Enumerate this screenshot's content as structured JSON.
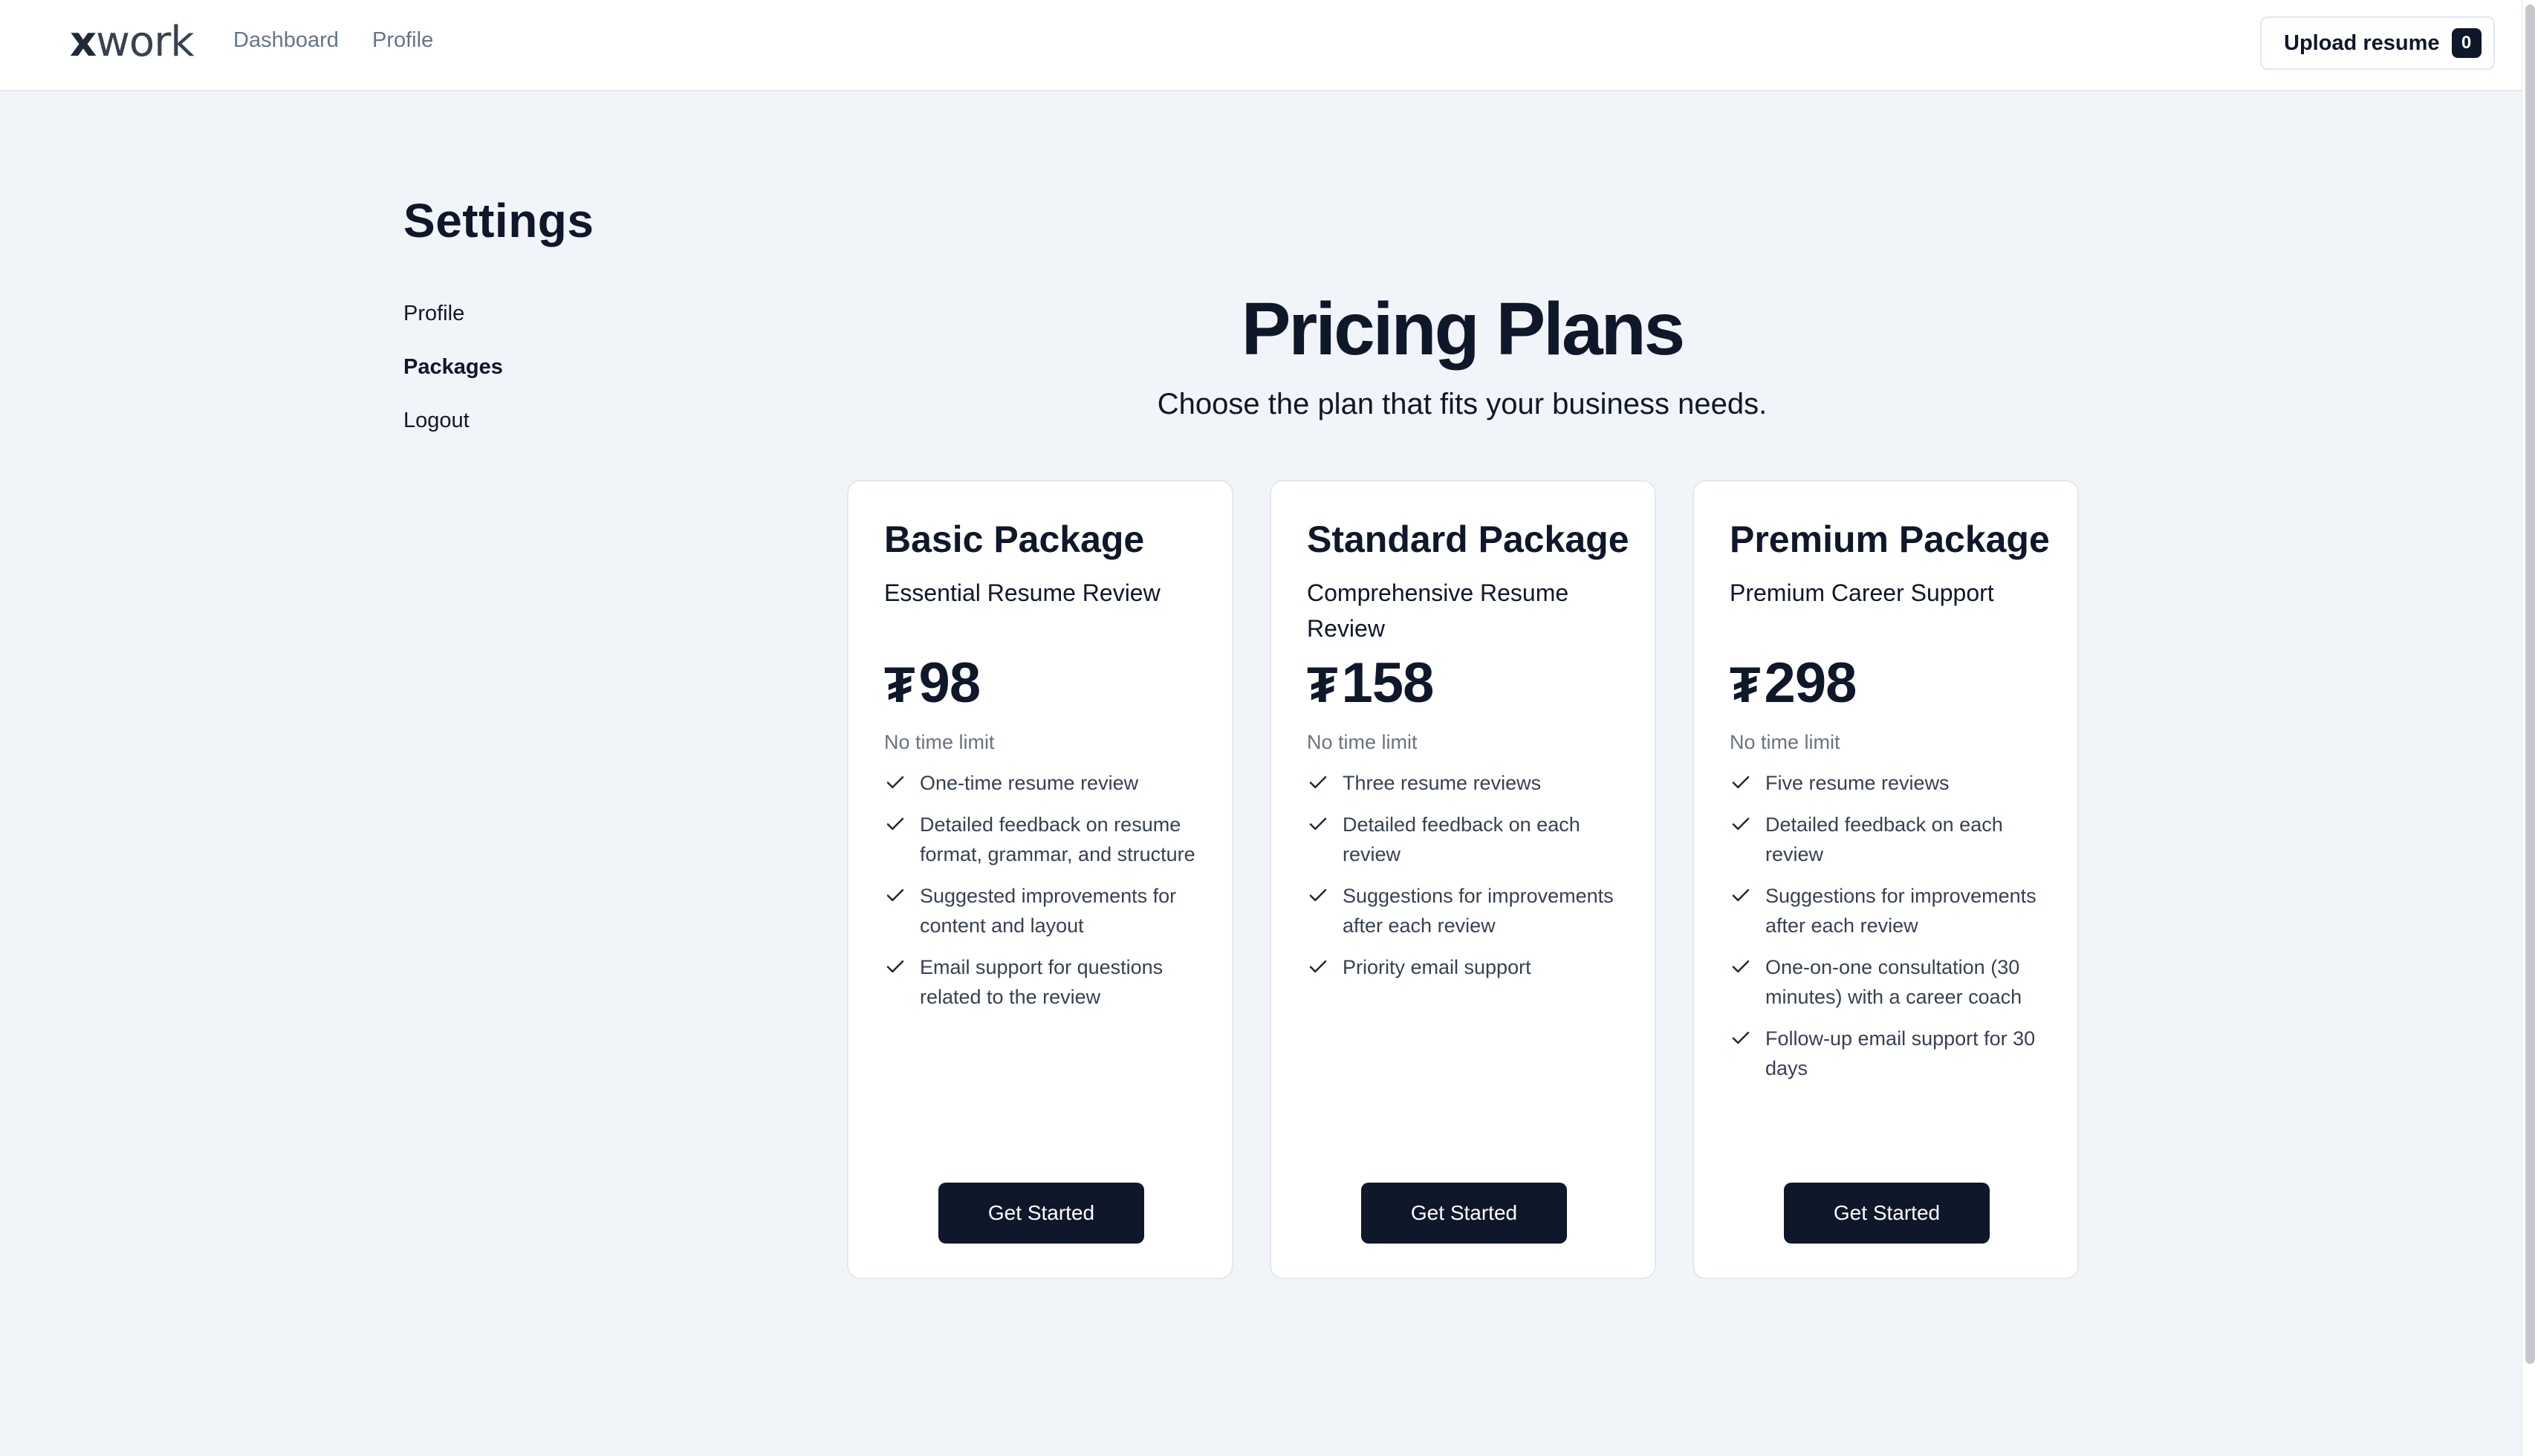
{
  "topbar": {
    "logo_x": "x",
    "logo_rest": "work",
    "nav": [
      "Dashboard",
      "Profile"
    ],
    "upload_label": "Upload resume",
    "upload_count": "0"
  },
  "sidebar": {
    "title": "Settings",
    "items": [
      "Profile",
      "Packages",
      "Logout"
    ],
    "active": "Packages"
  },
  "pricing": {
    "title": "Pricing Plans",
    "subtitle": "Choose the plan that fits your business needs.",
    "currency_symbol": "₮",
    "plans": [
      {
        "name": "Basic Package",
        "tagline": "Essential Resume Review",
        "price": "98",
        "period": "No time limit",
        "features": [
          "One-time resume review",
          "Detailed feedback on resume format, grammar, and structure",
          "Suggested improvements for content and layout",
          "Email support for questions related to the review"
        ],
        "cta": "Get Started"
      },
      {
        "name": "Standard Package",
        "tagline": "Comprehensive Resume Review",
        "price": "158",
        "period": "No time limit",
        "features": [
          "Three resume reviews",
          "Detailed feedback on each review",
          "Suggestions for improvements after each review",
          "Priority email support"
        ],
        "cta": "Get Started"
      },
      {
        "name": "Premium Package",
        "tagline": "Premium Career Support",
        "price": "298",
        "period": "No time limit",
        "features": [
          "Five resume reviews",
          "Detailed feedback on each review",
          "Suggestions for improvements after each review",
          "One-on-one consultation (30 minutes) with a career coach",
          "Follow-up email support for 30 days"
        ],
        "cta": "Get Started"
      }
    ]
  },
  "colors": {
    "background": "#f1f4f8",
    "primary": "#0f172a",
    "muted": "#6b7280"
  },
  "icons": {
    "feature": "check-icon"
  }
}
